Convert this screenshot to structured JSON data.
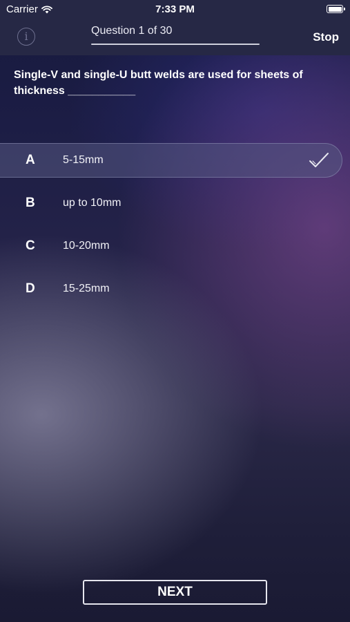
{
  "status_bar": {
    "carrier": "Carrier",
    "time": "7:33 PM"
  },
  "nav": {
    "info_icon": "info-icon",
    "info_glyph": "i",
    "title": "Question 1 of 30",
    "stop_label": "Stop"
  },
  "question": {
    "text": "Single-V and single-U butt welds are used for sheets of thickness ___________"
  },
  "answers": [
    {
      "letter": "A",
      "text": "5-15mm",
      "selected": true
    },
    {
      "letter": "B",
      "text": "up to 10mm",
      "selected": false
    },
    {
      "letter": "C",
      "text": "10-20mm",
      "selected": false
    },
    {
      "letter": "D",
      "text": "15-25mm",
      "selected": false
    }
  ],
  "next_label": "NEXT",
  "colors": {
    "bar_background": "#262845",
    "selected_row": "#555882",
    "info_icon": "#6e7090"
  }
}
